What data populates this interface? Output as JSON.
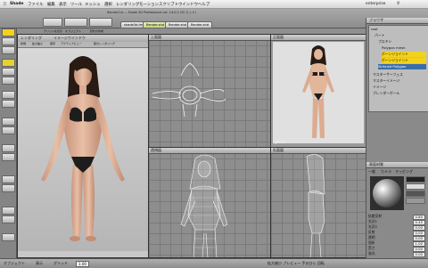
{
  "menubar": {
    "app_name": "Shade",
    "items": [
      "ファイル",
      "編集",
      "表示",
      "ツール",
      "メッシュ",
      "選択",
      "レンダリング",
      "モーション",
      "スクリプト",
      "ウインドウ",
      "ヘルプ"
    ],
    "window_title": "RenderCut — Shade 3D Professional ver. 14.0.0 (32 ビット)",
    "user": "enterprise"
  },
  "toolbar": {
    "buttons": [
      "グリッドを表示",
      "オブジェクト",
      "形状の作成",
      "幾何フィットする"
    ],
    "tabs": [
      "shade3d.frm",
      "Render.shd",
      "Render.shd",
      "Render.shd"
    ]
  },
  "render_window": {
    "tabs": [
      "レンダリング",
      "イメージウインドウ"
    ],
    "toolbar": [
      "新規",
      "拡大縮小",
      "保存",
      "アクティブビュー",
      "部分レンダリング"
    ]
  },
  "viewports": {
    "top_title": "上面図",
    "front_title": "正面図",
    "side_title": "右面図",
    "perspective_title": "透視図",
    "ground_label": "global"
  },
  "right_panel": {
    "browser_title": "ブラウザ",
    "tree": [
      "root",
      "パート",
      "プロキシ",
      "Polygon mesh",
      "ボーンジョイント",
      "ボーンジョイント",
      "Skinned Polygon",
      "マスターサーフェス",
      "マスターイメージ",
      "イメージ",
      "ブレンダーボール"
    ],
    "surface_title": "表面材質",
    "surface_tabs": [
      "一般",
      "カメラ",
      "マッピング"
    ],
    "props": [
      {
        "label": "拡散反射",
        "value": "0.80"
      },
      {
        "label": "光沢1",
        "value": "0.45"
      },
      {
        "label": "光沢2",
        "value": "0.00"
      },
      {
        "label": "反射",
        "value": "0.00"
      },
      {
        "label": "透明",
        "value": "0.00"
      },
      {
        "label": "屈折",
        "value": "1.00"
      },
      {
        "label": "荒さ",
        "value": "0.00"
      },
      {
        "label": "発光",
        "value": "0.00"
      }
    ],
    "colors": {
      "accent": "#f2d21d",
      "selected": "#3a6ea8"
    }
  },
  "statusbar": {
    "labels": [
      "オブジェクト",
      "表示",
      "グリッド"
    ],
    "zoom": "1.00",
    "info": "拡大縮小 プレビュー 手のひら 回転"
  }
}
